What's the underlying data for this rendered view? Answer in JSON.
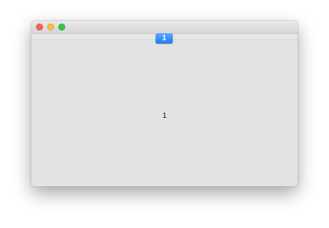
{
  "window": {
    "controls": {
      "close_icon": "close-icon",
      "minimize_icon": "minimize-icon",
      "zoom_icon": "zoom-icon"
    },
    "tabs": [
      {
        "label": "1",
        "selected": true
      }
    ],
    "content": {
      "label": "1"
    }
  },
  "colors": {
    "close": "#fc605c",
    "minimize": "#fdbc40",
    "zoom": "#34c84a",
    "selected_tab": "#2f88f8",
    "background": "#e3e3e3"
  }
}
